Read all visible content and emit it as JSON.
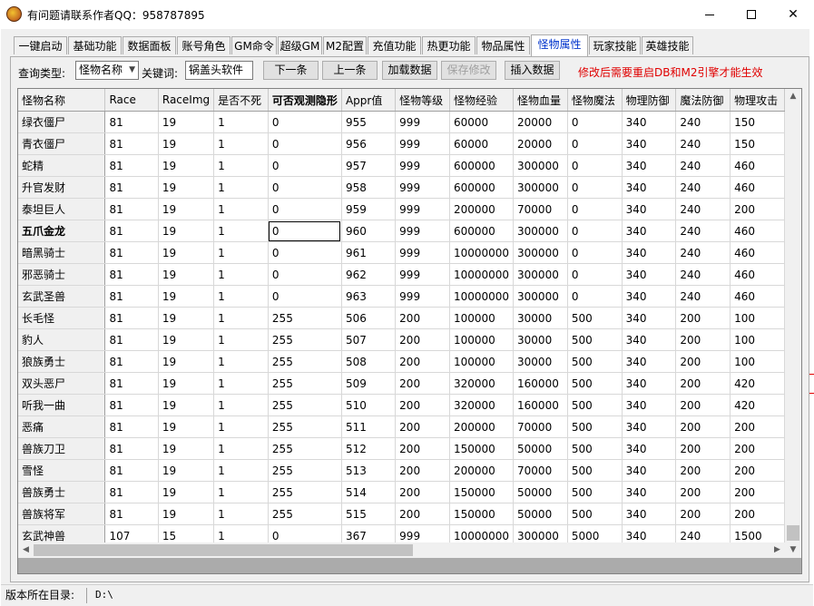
{
  "window": {
    "title": "有问题请联系作者QQ：958787895",
    "minimize_glyph": "",
    "maximize_glyph": "",
    "close_glyph": "✕"
  },
  "tabs": [
    {
      "label": "一键启动"
    },
    {
      "label": "基础功能"
    },
    {
      "label": "数据面板"
    },
    {
      "label": "账号角色"
    },
    {
      "label": "GM命令"
    },
    {
      "label": "超级GM"
    },
    {
      "label": "M2配置"
    },
    {
      "label": "充值功能"
    },
    {
      "label": "热更功能"
    },
    {
      "label": "物品属性"
    },
    {
      "label": "怪物属性",
      "active": true
    },
    {
      "label": "玩家技能"
    },
    {
      "label": "英雄技能"
    }
  ],
  "toolbar": {
    "query_type_label": "查询类型:",
    "query_type_value": "怪物名称",
    "keyword_label": "关键词:",
    "keyword_value": "锅盖头软件",
    "next_button": "下一条",
    "prev_button": "上一条",
    "load_button": "加载数据",
    "save_button": "保存修改",
    "insert_button": "插入数据",
    "warning": "修改后需要重启DB和M2引擎才能生效"
  },
  "grid": {
    "columns": [
      "怪物名称",
      "Race",
      "RaceImg",
      "是否不死",
      "可否观测隐形",
      "Appr值",
      "怪物等级",
      "怪物经验",
      "怪物血量",
      "怪物魔法",
      "物理防御",
      "魔法防御",
      "物理攻击"
    ],
    "rows": [
      [
        "绿衣僵尸",
        "81",
        "19",
        "1",
        "0",
        "955",
        "999",
        "60000",
        "20000",
        "0",
        "340",
        "240",
        "150"
      ],
      [
        "青衣僵尸",
        "81",
        "19",
        "1",
        "0",
        "956",
        "999",
        "60000",
        "20000",
        "0",
        "340",
        "240",
        "150"
      ],
      [
        "蛇精",
        "81",
        "19",
        "1",
        "0",
        "957",
        "999",
        "600000",
        "300000",
        "0",
        "340",
        "240",
        "460"
      ],
      [
        "升官发财",
        "81",
        "19",
        "1",
        "0",
        "958",
        "999",
        "600000",
        "300000",
        "0",
        "340",
        "240",
        "460"
      ],
      [
        "泰坦巨人",
        "81",
        "19",
        "1",
        "0",
        "959",
        "999",
        "200000",
        "70000",
        "0",
        "340",
        "240",
        "200"
      ],
      [
        "五爪金龙",
        "81",
        "19",
        "1",
        "0",
        "960",
        "999",
        "600000",
        "300000",
        "0",
        "340",
        "240",
        "460"
      ],
      [
        "暗黑骑士",
        "81",
        "19",
        "1",
        "0",
        "961",
        "999",
        "10000000",
        "300000",
        "0",
        "340",
        "240",
        "460"
      ],
      [
        "邪恶骑士",
        "81",
        "19",
        "1",
        "0",
        "962",
        "999",
        "10000000",
        "300000",
        "0",
        "340",
        "240",
        "460"
      ],
      [
        "玄武圣兽",
        "81",
        "19",
        "1",
        "0",
        "963",
        "999",
        "10000000",
        "300000",
        "0",
        "340",
        "240",
        "460"
      ],
      [
        "长毛怪",
        "81",
        "19",
        "1",
        "255",
        "506",
        "200",
        "100000",
        "30000",
        "500",
        "340",
        "200",
        "100"
      ],
      [
        "豹人",
        "81",
        "19",
        "1",
        "255",
        "507",
        "200",
        "100000",
        "30000",
        "500",
        "340",
        "200",
        "100"
      ],
      [
        "狼族勇士",
        "81",
        "19",
        "1",
        "255",
        "508",
        "200",
        "100000",
        "30000",
        "500",
        "340",
        "200",
        "100"
      ],
      [
        "双头恶尸",
        "81",
        "19",
        "1",
        "255",
        "509",
        "200",
        "320000",
        "160000",
        "500",
        "340",
        "200",
        "420"
      ],
      [
        "听我一曲",
        "81",
        "19",
        "1",
        "255",
        "510",
        "200",
        "320000",
        "160000",
        "500",
        "340",
        "200",
        "420"
      ],
      [
        "恶痛",
        "81",
        "19",
        "1",
        "255",
        "511",
        "200",
        "200000",
        "70000",
        "500",
        "340",
        "200",
        "200"
      ],
      [
        "兽族刀卫",
        "81",
        "19",
        "1",
        "255",
        "512",
        "200",
        "150000",
        "50000",
        "500",
        "340",
        "200",
        "200"
      ],
      [
        "雪怪",
        "81",
        "19",
        "1",
        "255",
        "513",
        "200",
        "200000",
        "70000",
        "500",
        "340",
        "200",
        "200"
      ],
      [
        "兽族勇士",
        "81",
        "19",
        "1",
        "255",
        "514",
        "200",
        "150000",
        "50000",
        "500",
        "340",
        "200",
        "200"
      ],
      [
        "兽族将军",
        "81",
        "19",
        "1",
        "255",
        "515",
        "200",
        "150000",
        "50000",
        "500",
        "340",
        "200",
        "200"
      ],
      [
        "玄武神兽",
        "107",
        "15",
        "1",
        "0",
        "367",
        "999",
        "10000000",
        "300000",
        "5000",
        "340",
        "240",
        "1500"
      ]
    ],
    "selected_row": 5,
    "focused_column": 4,
    "scroll_up_glyph": "▲",
    "scroll_down_glyph": "▼",
    "scroll_left_glyph": "◀",
    "scroll_right_glyph": "▶"
  },
  "status": {
    "label": "版本所在目录:",
    "value": "D:\\"
  }
}
